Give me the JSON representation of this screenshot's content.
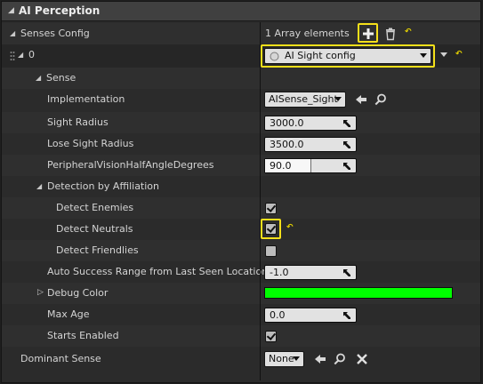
{
  "header": {
    "title": "AI Perception"
  },
  "senses_config": {
    "label": "Senses Config",
    "count_text": "1 Array elements",
    "element_index": "0",
    "element_value": "AI Sight config"
  },
  "sense": {
    "label": "Sense",
    "implementation": {
      "label": "Implementation",
      "value": "AISense_Sight"
    },
    "sight_radius": {
      "label": "Sight Radius",
      "value": "3000.0"
    },
    "lose_sight_radius": {
      "label": "Lose Sight Radius",
      "value": "3500.0"
    },
    "peripheral": {
      "label": "PeripheralVisionHalfAngleDegrees",
      "value": "90.0",
      "slider_fraction": 0.5
    },
    "affiliation": {
      "label": "Detection by Affiliation",
      "enemies": {
        "label": "Detect Enemies",
        "checked": true
      },
      "neutrals": {
        "label": "Detect Neutrals",
        "checked": true
      },
      "friendlies": {
        "label": "Detect Friendlies",
        "checked": false
      }
    },
    "auto_success": {
      "label": "Auto Success Range from Last Seen Location",
      "value": "-1.0"
    },
    "debug_color": {
      "label": "Debug Color",
      "color": "#00ff00"
    },
    "max_age": {
      "label": "Max Age",
      "value": "0.0"
    },
    "starts_enabled": {
      "label": "Starts Enabled",
      "checked": true
    }
  },
  "dominant_sense": {
    "label": "Dominant Sense",
    "value": "None"
  },
  "colors": {
    "highlight": "#f5e01a",
    "reset": "#e8d400",
    "debug_color": "#00ff00"
  }
}
